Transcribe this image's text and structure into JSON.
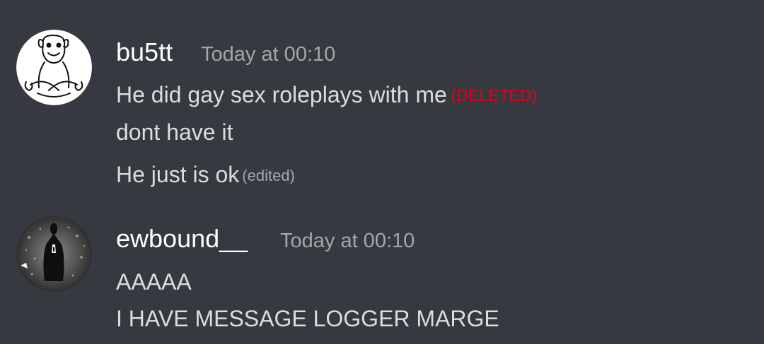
{
  "colors": {
    "background": "#36393f",
    "username": "#ffffff",
    "message_text": "#dcddde",
    "timestamp": "#a3a6aa",
    "deleted_tag": "#e0001c"
  },
  "messages": [
    {
      "author": "bu5tt",
      "timestamp": "Today at 00:10",
      "avatar_icon": "cartoon-face-avatar",
      "lines": [
        {
          "text": "He did gay sex roleplays with me",
          "tag": "(DELETED)"
        },
        {
          "text": "dont have it"
        },
        {
          "text": "He just is ok",
          "tag": "(edited)"
        }
      ]
    },
    {
      "author": "ewbound__",
      "timestamp": "Today at 00:10",
      "avatar_icon": "dark-photo-avatar",
      "lines": [
        {
          "text": "AAAAA"
        },
        {
          "text": "I HAVE MESSAGE LOGGER MARGE"
        }
      ]
    }
  ]
}
